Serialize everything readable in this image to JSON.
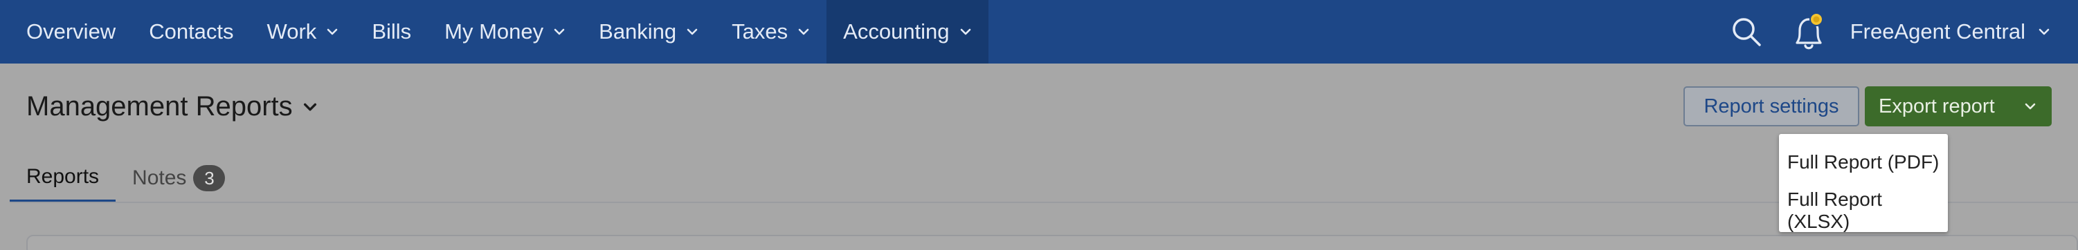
{
  "nav": {
    "items": [
      {
        "label": "Overview"
      },
      {
        "label": "Contacts"
      },
      {
        "label": "Work"
      },
      {
        "label": "Bills"
      },
      {
        "label": "My Money"
      },
      {
        "label": "Banking"
      },
      {
        "label": "Taxes"
      },
      {
        "label": "Accounting"
      }
    ],
    "company": "FreeAgent Central"
  },
  "header": {
    "title": "Management Reports",
    "settings_label": "Report settings",
    "export_label": "Export report"
  },
  "tabs": [
    {
      "label": "Reports"
    },
    {
      "label": "Notes",
      "badge": "3"
    }
  ],
  "export_menu": {
    "items": [
      {
        "label": "Full Report (PDF)"
      },
      {
        "label": "Full Report (XLSX)"
      }
    ]
  },
  "icons": {
    "search": "search-icon",
    "notifications": "bell-icon",
    "dropdown": "chevron-down-icon"
  },
  "colors": {
    "nav_background": "#1d4787",
    "nav_active": "#163a70",
    "export_button": "#3c6b2a",
    "tab_underline": "#1d4787",
    "notification_dot": "#f4c430"
  }
}
